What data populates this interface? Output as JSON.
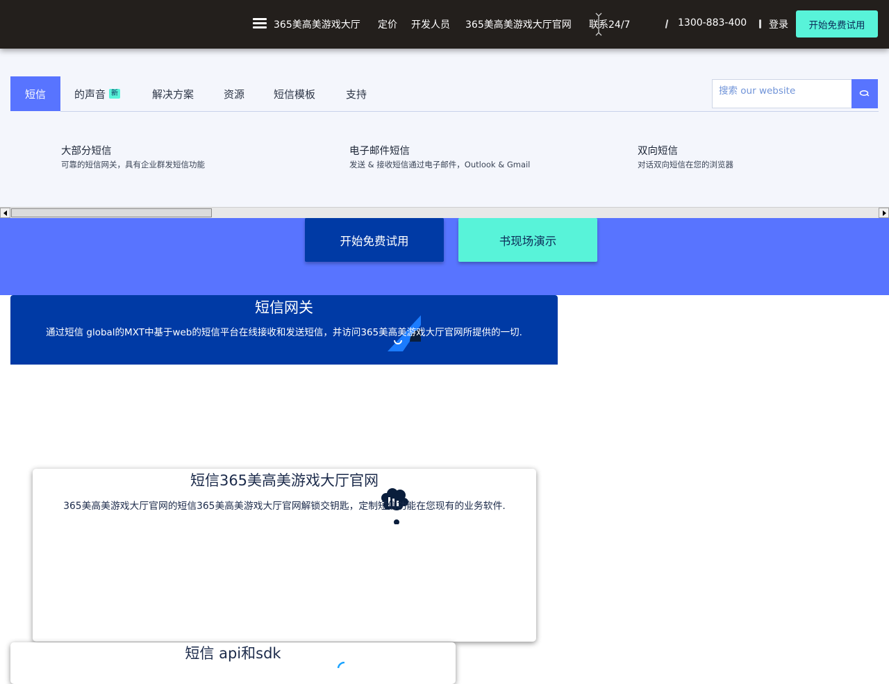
{
  "topbar": {
    "nav": [
      "365美高美游戏大厅",
      "定价",
      "开发人员",
      "365美高美游戏大厅官网",
      "联系24/7"
    ],
    "phone": "1300-883-400",
    "login": "登录",
    "trial_button": "开始免费试用",
    "background_color": "#231f1c",
    "accent_color": "#58f3d9"
  },
  "megamenu": {
    "tabs": [
      {
        "label": "短信",
        "active": true
      },
      {
        "label": "的声音",
        "badge": "新"
      },
      {
        "label": "解决方案"
      },
      {
        "label": "资源"
      },
      {
        "label": "短信模板"
      },
      {
        "label": "支持"
      }
    ],
    "search": {
      "placeholder": "搜索 our website",
      "icon": "search-icon"
    },
    "items": [
      {
        "title": "大部分短信",
        "desc": "可靠的短信网关，具有企业群发短信功能"
      },
      {
        "title": "电子邮件短信",
        "desc": "发送 & 接收短信通过电子邮件，Outlook & Gmail"
      },
      {
        "title": "双向短信",
        "desc": "对话双向短信在您的浏览器"
      }
    ],
    "active_tab_color": "#5874ff"
  },
  "hero": {
    "primary_button": "开始免费试用",
    "secondary_button": "书现场演示",
    "background_color": "#5874ff",
    "primary_color": "#003aa5"
  },
  "cards": [
    {
      "title": "短信网关",
      "desc": "通过短信 global的MXT中基于web的短信平台在线接收和发送短信，并访问365美高美游戏大厅官网所提供的一切.",
      "icon": "gateway-icon"
    },
    {
      "title": "短信365美高美游戏大厅官网",
      "desc": "365美高美游戏大厅官网的短信365美高美游戏大厅官网解锁交钥匙，定制短信功能在您现有的业务软件.",
      "icon": "integration-icon"
    },
    {
      "title": "短信 api和sdk",
      "icon": "api-icon"
    }
  ]
}
